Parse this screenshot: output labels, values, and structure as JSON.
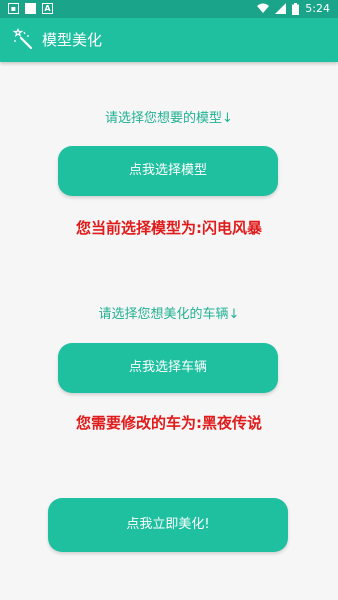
{
  "status_bar": {
    "time": "5:24",
    "notification_icons": [
      "image-icon",
      "app-icon",
      "a-icon"
    ],
    "system_icons": [
      "wifi-icon",
      "signal-icon",
      "battery-icon"
    ]
  },
  "app_bar": {
    "title": "模型美化",
    "icon": "magic-wand-icon"
  },
  "model_section": {
    "prompt": "请选择您想要的模型↓",
    "button_label": "点我选择模型",
    "result": "您当前选择模型为:闪电风暴"
  },
  "vehicle_section": {
    "prompt": "请选择您想美化的车辆↓",
    "button_label": "点我选择车辆",
    "result": "您需要修改的车为:黑夜传说"
  },
  "action": {
    "button_label": "点我立即美化!"
  },
  "colors": {
    "status_bar": "#1aa58a",
    "app_bar": "#1ec0a0",
    "accent_text": "#23b194",
    "result_text": "#e01b1b",
    "background": "#f6f6f6"
  }
}
